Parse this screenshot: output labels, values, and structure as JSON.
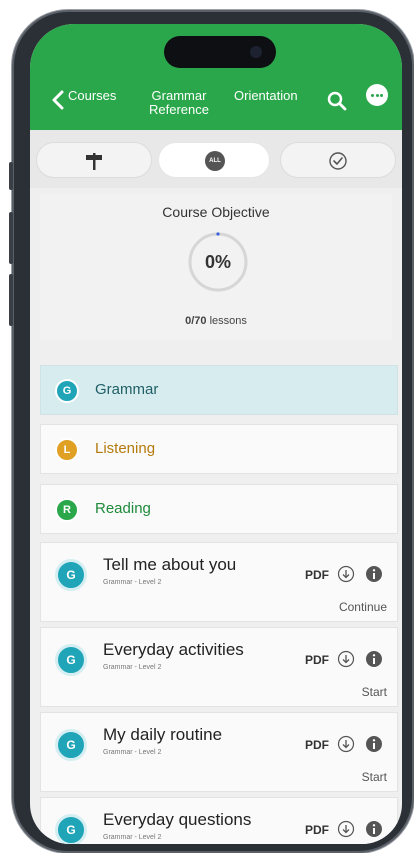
{
  "header": {
    "back_label": "Courses",
    "grammar_label": "Grammar\nReference",
    "orientation_label": "Orientation",
    "accent_color": "#2aa74a"
  },
  "filters": [
    {
      "name": "signpost",
      "icon": "signpost-icon"
    },
    {
      "name": "all",
      "icon": "all-icon",
      "badge": "ALL",
      "active": true
    },
    {
      "name": "completed",
      "icon": "check-circle-icon"
    }
  ],
  "objective": {
    "title": "Course Objective",
    "percent": "0%",
    "lessons_done": "0/70",
    "lessons_suffix": " lessons"
  },
  "categories": [
    {
      "letter": "G",
      "label": "Grammar",
      "color": "#20a5b8",
      "text_color": "#1f5f66",
      "selected": true
    },
    {
      "letter": "L",
      "label": "Listening",
      "color": "#e0a024",
      "text_color": "#b57a0c",
      "selected": false
    },
    {
      "letter": "R",
      "label": "Reading",
      "color": "#2aa74a",
      "text_color": "#1f8a3b",
      "selected": false
    }
  ],
  "lessons": [
    {
      "letter": "G",
      "title": "Tell me about you",
      "subtitle": "Grammar - Level 2",
      "pdf": "PDF",
      "action": "Continue"
    },
    {
      "letter": "G",
      "title": "Everyday activities",
      "subtitle": "Grammar - Level 2",
      "pdf": "PDF",
      "action": "Start"
    },
    {
      "letter": "G",
      "title": "My daily routine",
      "subtitle": "Grammar - Level 2",
      "pdf": "PDF",
      "action": "Start"
    },
    {
      "letter": "G",
      "title": "Everyday questions",
      "subtitle": "Grammar - Level 2",
      "pdf": "PDF",
      "action": ""
    }
  ]
}
